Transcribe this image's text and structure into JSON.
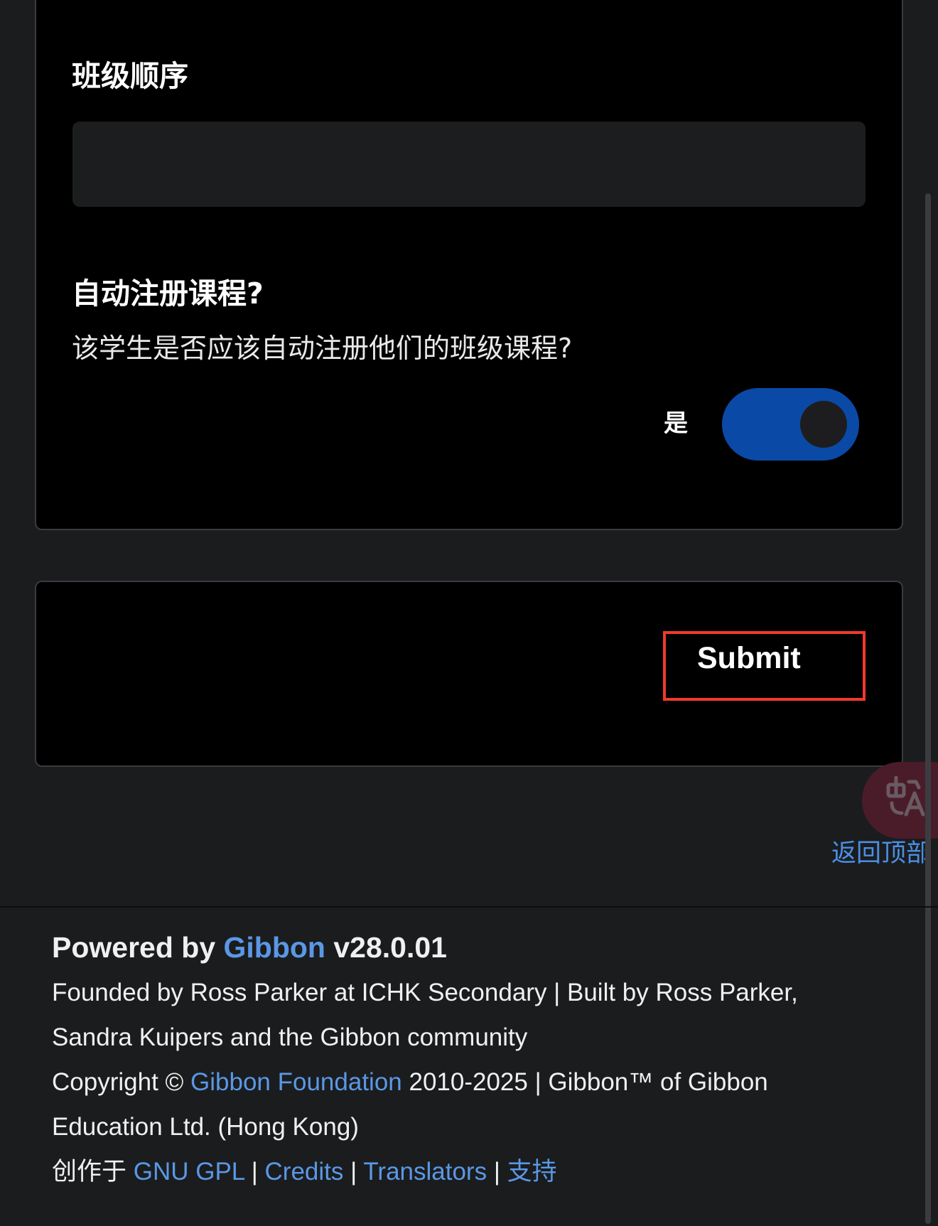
{
  "form": {
    "roll_order_label": "班级顺序",
    "roll_order_value": "",
    "auto_enrol_label": "自动注册课程?",
    "auto_enrol_description": "该学生是否应该自动注册他们的班级课程?",
    "toggle_label": "是",
    "toggle_state": true,
    "toggle_color": "#0a4aa6"
  },
  "actions": {
    "submit_label": "Submit",
    "highlight_color": "#f2382d"
  },
  "floating": {
    "translate_icon": "translate-icon",
    "back_to_top_label": "返回顶部"
  },
  "footer": {
    "powered_prefix": "Powered by ",
    "powered_link": "Gibbon",
    "powered_version": " v28.0.01",
    "line1": "Founded by Ross Parker at ICHK Secondary | Built by Ross Parker,",
    "line2": "Sandra Kuipers and the Gibbon community",
    "copyright_prefix": "Copyright © ",
    "copyright_link": "Gibbon Foundation",
    "copyright_suffix": " 2010-2025 | Gibbon™ of Gibbon",
    "line4": "Education Ltd. (Hong Kong)",
    "license_prefix": "创作于 ",
    "license_link": "GNU GPL",
    "sep1": " | ",
    "credits_link": "Credits",
    "sep2": " | ",
    "translators_link": "Translators",
    "sep3": " | ",
    "support_link": "支持",
    "link_color": "#5a98e6"
  }
}
